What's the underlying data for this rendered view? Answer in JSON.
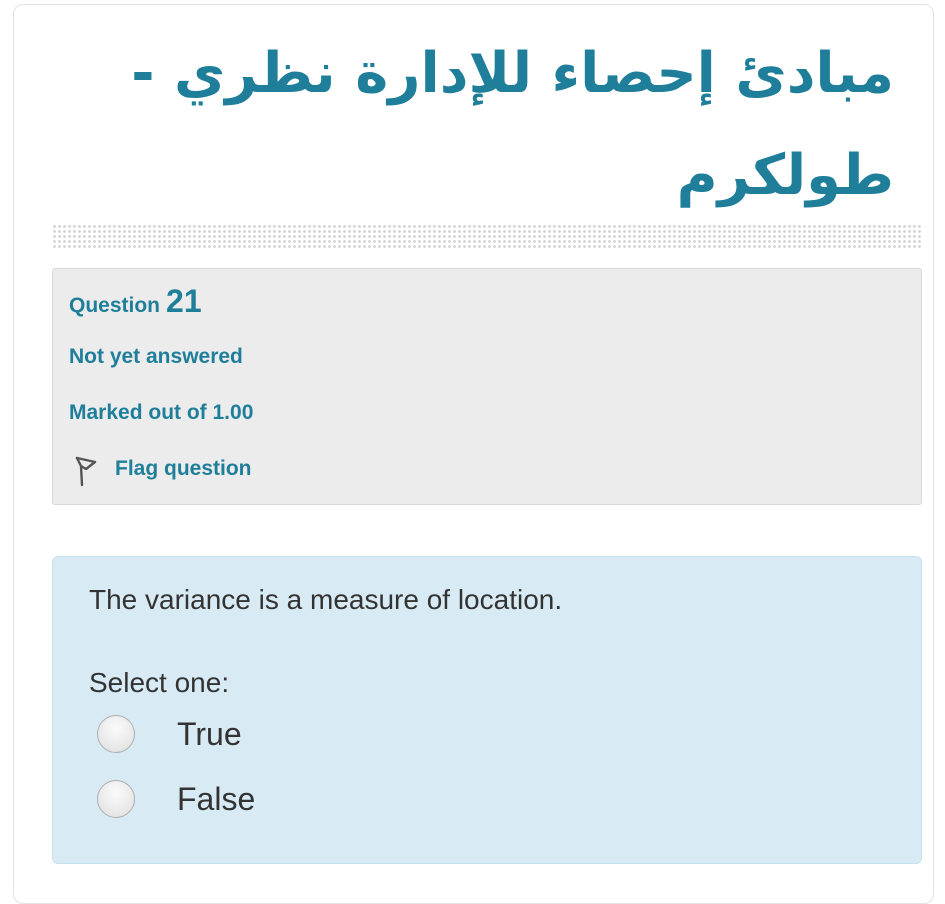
{
  "course": {
    "title": "مبادئ إحصاء للإدارة نظري - طولكرم"
  },
  "question_info": {
    "label": "Question",
    "number": "21",
    "status": "Not yet answered",
    "marks": "Marked out of 1.00",
    "flag_label": "Flag question",
    "flag_icon": "flag-icon"
  },
  "question": {
    "text": "The variance is a measure of location.",
    "prompt": "Select one:",
    "options": [
      {
        "label": "True",
        "selected": false
      },
      {
        "label": "False",
        "selected": false
      }
    ]
  },
  "colors": {
    "accent": "#1f7e9a",
    "info_bg": "#ececec",
    "content_bg": "#d8ebf5",
    "text": "#333333"
  }
}
